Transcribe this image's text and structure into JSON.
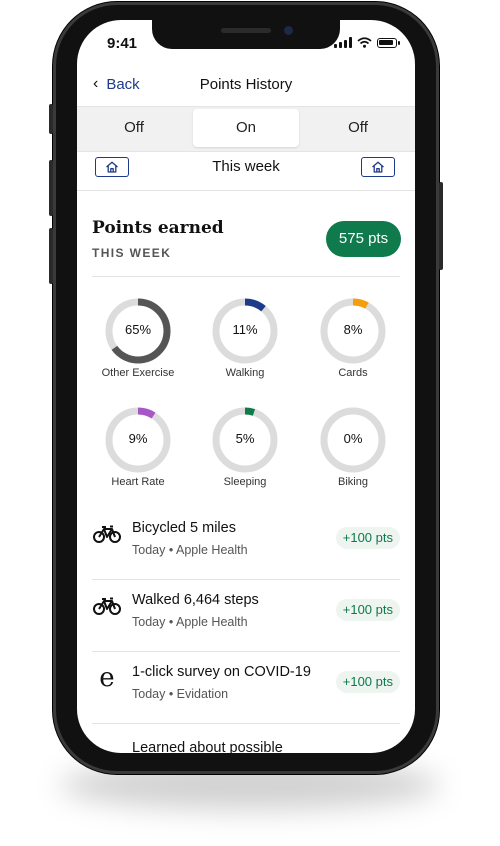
{
  "status_bar": {
    "time": "9:41"
  },
  "nav": {
    "back_label": "Back",
    "title": "Points History"
  },
  "segments": [
    {
      "label": "Off",
      "active": false
    },
    {
      "label": "On",
      "active": true
    },
    {
      "label": "Off",
      "active": false
    }
  ],
  "week": {
    "label": "This week"
  },
  "points": {
    "title": "Points earned",
    "subtitle": "THIS WEEK",
    "total": "575 pts"
  },
  "donuts": [
    {
      "value": "65%",
      "label": "Other Exercise",
      "fraction": 0.65,
      "color": "#555555"
    },
    {
      "value": "11%",
      "label": "Walking",
      "fraction": 0.11,
      "color": "#1e3a8a"
    },
    {
      "value": "8%",
      "label": "Cards",
      "fraction": 0.08,
      "color": "#f59e0b"
    },
    {
      "value": "9%",
      "label": "Heart Rate",
      "fraction": 0.09,
      "color": "#a855c7"
    },
    {
      "value": "5%",
      "label": "Sleeping",
      "fraction": 0.05,
      "color": "#0f7a4b"
    },
    {
      "value": "0%",
      "label": "Biking",
      "fraction": 0.0,
      "color": "#cccccc"
    }
  ],
  "activities": [
    {
      "title": "Bicycled 5 miles",
      "meta": "Today • Apple Health",
      "points": "+100 pts",
      "icon": "bike-icon"
    },
    {
      "title": "Walked 6,464 steps",
      "meta": "Today • Apple Health",
      "points": "+100 pts",
      "icon": "bike-icon"
    },
    {
      "title": "1-click survey on COVID-19",
      "meta": "Today • Evidation",
      "points": "+100 pts",
      "icon": "evidation-logo"
    },
    {
      "title": "Learned about possible",
      "meta": "",
      "points": "",
      "icon": ""
    }
  ],
  "colors": {
    "accent_green": "#0f7a4b",
    "link_blue": "#1e3a8a",
    "ring_track": "#dcdcdc"
  }
}
